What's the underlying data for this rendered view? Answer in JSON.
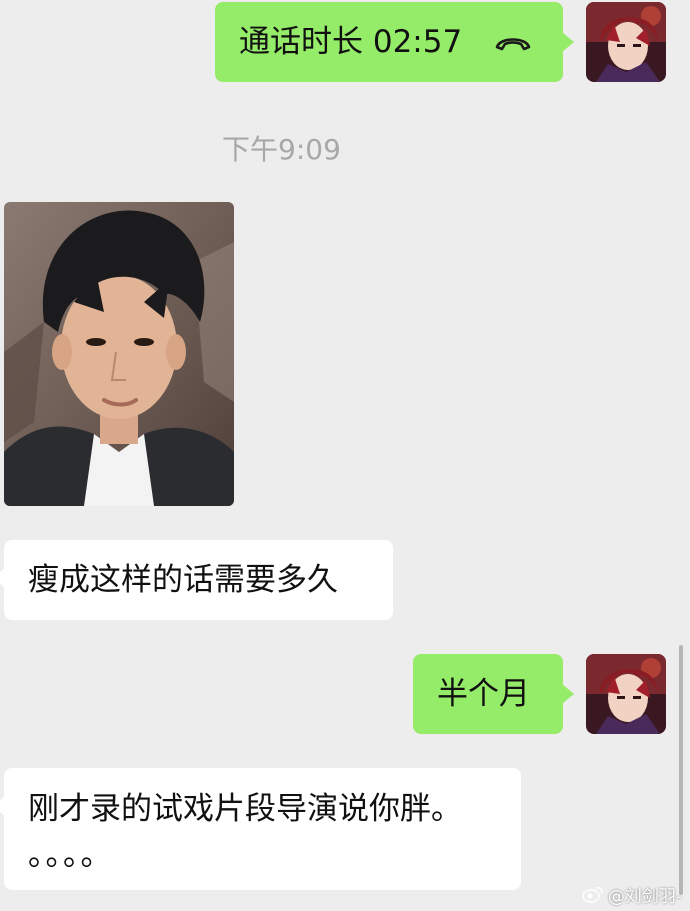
{
  "messages": {
    "call": {
      "text": "通话时长 02:57",
      "icon": "phone-hangup-icon"
    },
    "timestamp": "下午9:09",
    "received_1": "瘦成这样的话需要多久",
    "sent_2": "半个月",
    "received_3_line1": "刚才录的试戏片段导演说你胖。",
    "received_3_line2": "。。。。"
  },
  "watermark": {
    "text": "@刘剑羽-",
    "icon": "weibo-icon"
  },
  "colors": {
    "background": "#ededed",
    "sent_bubble": "#95ec69",
    "received_bubble": "#ffffff",
    "timestamp_text": "#a8a8a8"
  }
}
